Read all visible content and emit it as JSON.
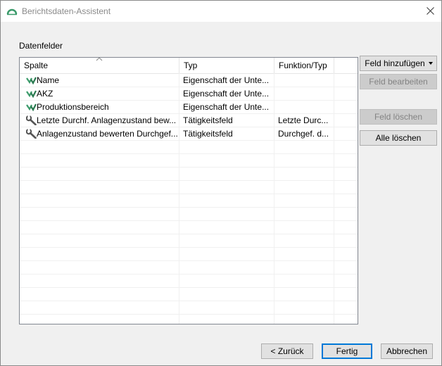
{
  "window": {
    "title": "Berichtsdaten-Assistent"
  },
  "section_label": "Datenfelder",
  "table": {
    "columns": [
      "Spalte",
      "Typ",
      "Funktion/Typ"
    ],
    "rows": [
      {
        "icon": "property-icon",
        "spalte": "Name",
        "typ": "Eigenschaft der Unte...",
        "funktion": ""
      },
      {
        "icon": "property-icon",
        "spalte": "AKZ",
        "typ": "Eigenschaft der Unte...",
        "funktion": ""
      },
      {
        "icon": "property-icon",
        "spalte": "Produktionsbereich",
        "typ": "Eigenschaft der Unte...",
        "funktion": ""
      },
      {
        "icon": "wrench-icon",
        "spalte": "Letzte Durchf. Anlagenzustand bew...",
        "typ": "Tätigkeitsfeld",
        "funktion": "Letzte Durc..."
      },
      {
        "icon": "wrench-icon",
        "spalte": "Anlagenzustand bewerten Durchgef...",
        "typ": "Tätigkeitsfeld",
        "funktion": "Durchgef. d..."
      }
    ]
  },
  "side_buttons": {
    "add_field": "Feld hinzufügen",
    "edit_field": "Feld bearbeiten",
    "delete_field": "Feld löschen",
    "delete_all": "Alle löschen"
  },
  "footer_buttons": {
    "back": "< Zurück",
    "finish": "Fertig",
    "cancel": "Abbrechen"
  },
  "colors": {
    "accent": "#0078d7",
    "icon_green": "#3a9a6a"
  }
}
